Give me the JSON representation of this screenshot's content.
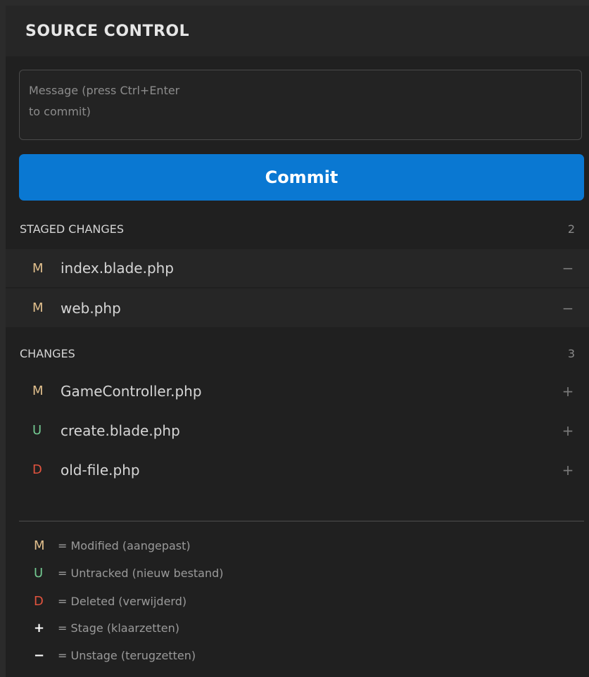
{
  "header": {
    "title": "SOURCE CONTROL"
  },
  "commit_box": {
    "placeholder": "Message (press Ctrl+Enter\nto commit)",
    "button_label": "Commit"
  },
  "staged": {
    "title": "STAGED CHANGES",
    "count": "2",
    "action_symbol": "−",
    "items": [
      {
        "status": "M",
        "name": "index.blade.php"
      },
      {
        "status": "M",
        "name": "web.php"
      }
    ]
  },
  "changes": {
    "title": "CHANGES",
    "count": "3",
    "action_symbol": "+",
    "items": [
      {
        "status": "M",
        "name": "GameController.php"
      },
      {
        "status": "U",
        "name": "create.blade.php"
      },
      {
        "status": "D",
        "name": "old-file.php"
      }
    ]
  },
  "legend": [
    {
      "symbol": "M",
      "text": "= Modified (aangepast)"
    },
    {
      "symbol": "U",
      "text": "= Untracked (nieuw bestand)"
    },
    {
      "symbol": "D",
      "text": "= Deleted (verwijderd)"
    },
    {
      "symbol": "+",
      "text": "= Stage (klaarzetten)"
    },
    {
      "symbol": "−",
      "text": "= Unstage (terugzetten)"
    }
  ],
  "colors": {
    "modified": "#e2c08d",
    "untracked": "#73c991",
    "deleted": "#e0533e",
    "accent": "#0a78d2"
  }
}
